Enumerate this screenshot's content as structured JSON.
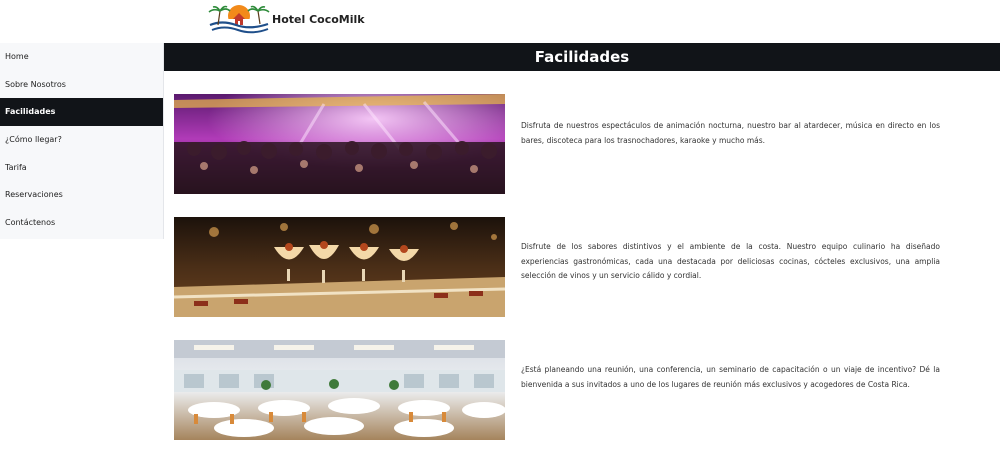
{
  "header": {
    "brand_name": "Hotel CocoMilk",
    "logo_icon": "hotel-sunset-palm-logo"
  },
  "sidebar": {
    "items": [
      {
        "label": "Home",
        "active": false
      },
      {
        "label": "Sobre Nosotros",
        "active": false
      },
      {
        "label": "Facilidades",
        "active": true
      },
      {
        "label": "¿Cómo llegar?",
        "active": false
      },
      {
        "label": "Tarifa",
        "active": false
      },
      {
        "label": "Reservaciones",
        "active": false
      },
      {
        "label": "Contáctenos",
        "active": false
      }
    ]
  },
  "main": {
    "title": "Facilidades",
    "facilities": [
      {
        "image": "nightclub-party-photo",
        "text": "Disfruta de nuestros espectáculos de animación nocturna, nuestro bar al atardecer, música en directo en los bares, discoteca para los trasnochadores, karaoke y mucho más."
      },
      {
        "image": "dessert-buffet-photo",
        "text": "Disfrute de los sabores distintivos y el ambiente de la costa. Nuestro equipo culinario ha diseñado experiencias gastronómicas, cada una destacada por deliciosas cocinas, cócteles exclusivos, una amplia selección de vinos y un servicio cálido y cordial."
      },
      {
        "image": "banquet-hall-photo",
        "text": "¿Está planeando una reunión, una conferencia, un seminario de capacitación o un viaje de incentivo? Dé la bienvenida a sus invitados a uno de los lugares de reunión más exclusivos y acogedores de Costa Rica."
      }
    ]
  },
  "colors": {
    "dark_bar": "#111418",
    "sidebar_bg": "#f7f8fa",
    "text": "#333333"
  }
}
